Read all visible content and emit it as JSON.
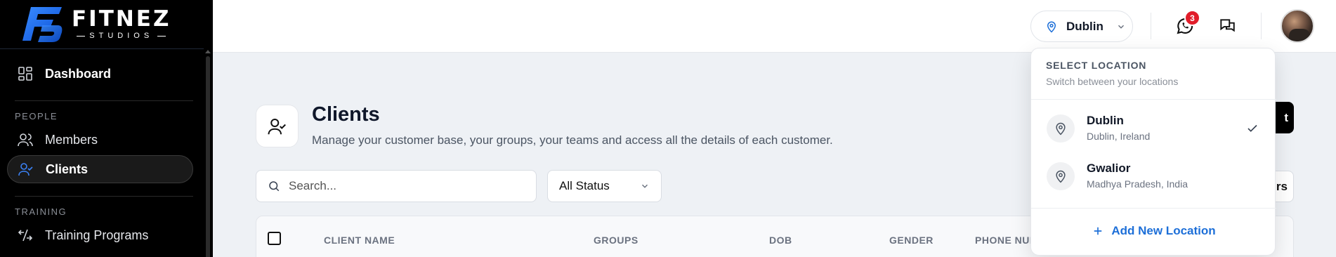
{
  "brand": {
    "name": "FITNEZ",
    "tagline": "STUDIOS"
  },
  "sidebar": {
    "items": [
      {
        "label": "Dashboard"
      },
      {
        "label": "Members"
      },
      {
        "label": "Clients"
      },
      {
        "label": "Training Programs"
      }
    ],
    "sections": {
      "people": "PEOPLE",
      "training": "TRAINING"
    }
  },
  "header": {
    "location": "Dublin",
    "notification_count": "3"
  },
  "main": {
    "title": "Clients",
    "subtitle": "Manage your customer base, your groups, your teams and access all the details of each customer.",
    "search_placeholder": "Search...",
    "status_filter": "All Status",
    "add_button_partial": "t",
    "filters_button_partial": "rs",
    "table_headers": [
      "CLIENT NAME",
      "GROUPS",
      "DOB",
      "GENDER",
      "PHONE NUM"
    ]
  },
  "location_menu": {
    "title": "SELECT LOCATION",
    "subtitle": "Switch between your locations",
    "locations": [
      {
        "name": "Dublin",
        "region": "Dublin, Ireland",
        "selected": true
      },
      {
        "name": "Gwalior",
        "region": "Madhya Pradesh, India",
        "selected": false
      }
    ],
    "add_label": "Add New Location"
  },
  "colors": {
    "accent": "#1d6fd8",
    "badge": "#e11d2a",
    "logo_blue": "#1e78ff"
  },
  "icons": [
    "dashboard-icon",
    "members-icon",
    "clients-icon",
    "training-icon",
    "map-pin-icon",
    "whatsapp-icon",
    "chat-icon",
    "search-icon",
    "check-icon",
    "plus-icon",
    "chevron-down-icon"
  ]
}
